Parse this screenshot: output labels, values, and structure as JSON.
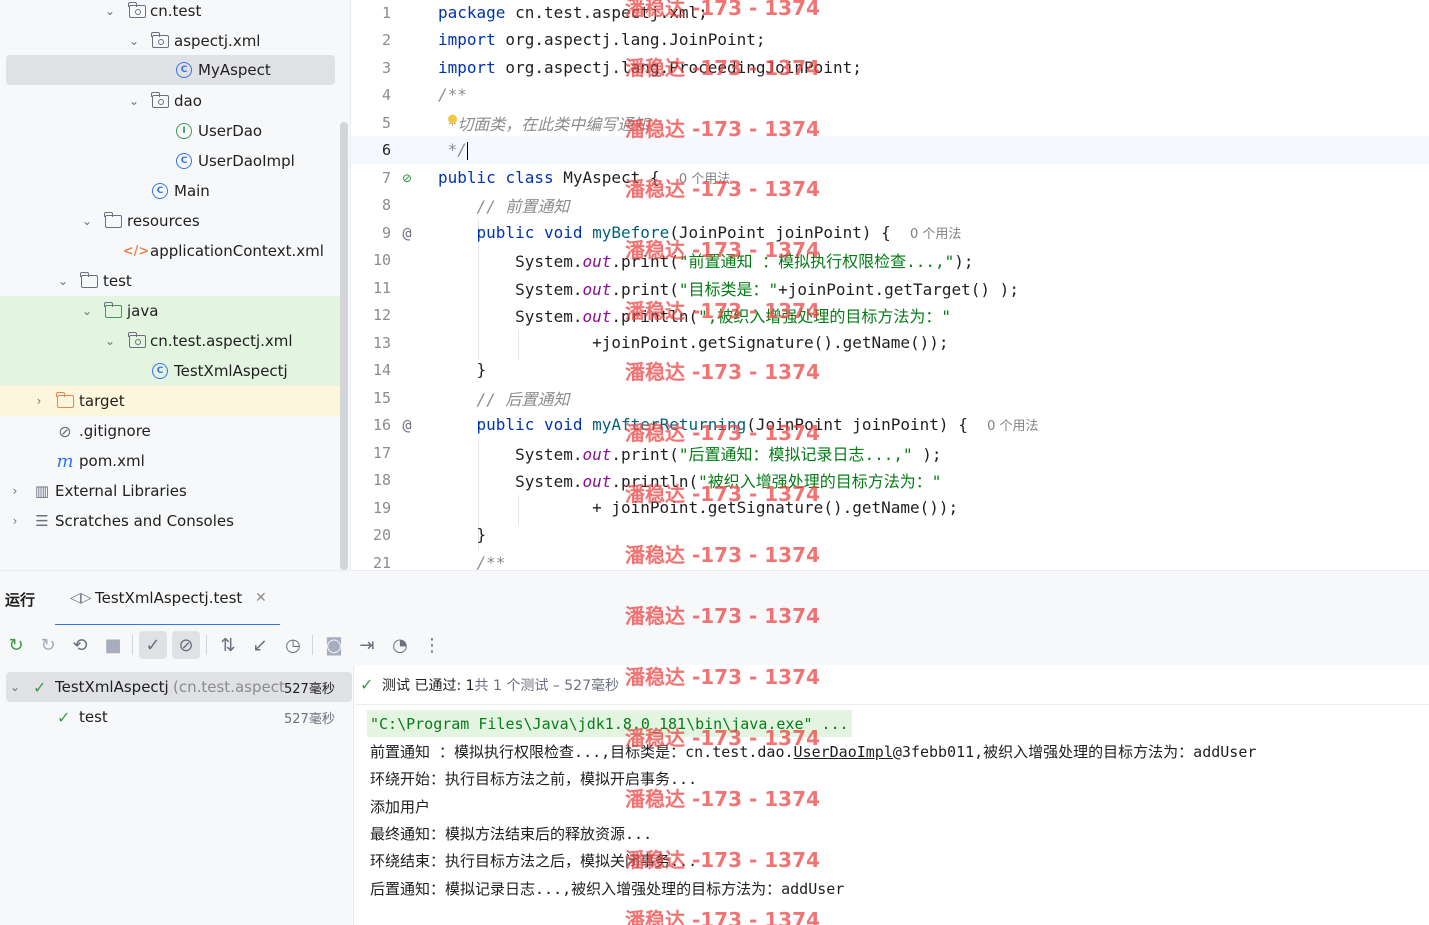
{
  "project_tree": {
    "items": [
      {
        "label": "cn.test",
        "icon": "package-icon"
      },
      {
        "label": "aspectj.xml",
        "icon": "package-icon"
      },
      {
        "label": "MyAspect",
        "icon": "class-icon"
      },
      {
        "label": "dao",
        "icon": "package-icon"
      },
      {
        "label": "UserDao",
        "icon": "interface-icon"
      },
      {
        "label": "UserDaoImpl",
        "icon": "class-icon"
      },
      {
        "label": "Main",
        "icon": "main-class-icon"
      },
      {
        "label": "resources",
        "icon": "resources-folder-icon"
      },
      {
        "label": "applicationContext.xml",
        "icon": "xml-file-icon"
      },
      {
        "label": "test",
        "icon": "folder-icon"
      },
      {
        "label": "java",
        "icon": "test-source-folder-icon"
      },
      {
        "label": "cn.test.aspectj.xml",
        "icon": "package-icon"
      },
      {
        "label": "TestXmlAspectj",
        "icon": "test-class-icon"
      },
      {
        "label": "target",
        "icon": "excluded-folder-icon"
      },
      {
        "label": ".gitignore",
        "icon": "ignore-file-icon"
      },
      {
        "label": "pom.xml",
        "icon": "maven-icon"
      },
      {
        "label": "External Libraries",
        "icon": "library-icon"
      },
      {
        "label": "Scratches and Consoles",
        "icon": "scratches-icon"
      }
    ],
    "icon_letters": {
      "class": "C",
      "interface": "I"
    }
  },
  "editor": {
    "line_numbers": [
      "1",
      "2",
      "3",
      "4",
      "5",
      "6",
      "7",
      "8",
      "9",
      "10",
      "11",
      "12",
      "13",
      "14",
      "15",
      "16",
      "17",
      "18",
      "19",
      "20",
      "21"
    ],
    "tokens": {
      "l1_kw": "package",
      "l1_rest": " cn.test.aspectj.xml;",
      "l2_kw": "import",
      "l2_rest": " org.aspectj.lang.JoinPoint;",
      "l3_kw": "import",
      "l3_rest": " org.aspectj.lang.ProceedingJoinPoint;",
      "l4_cmt": "/**",
      "l5_cmt": " *切面类，在此类中编写通知",
      "l6_cmt": " */",
      "l7_kw1": "public",
      "l7_kw2": "class",
      "l7_rest": " MyAspect {",
      "l7_hint": "0 个用法",
      "l8_cmt": "    // 前置通知",
      "l9_kw1": "public",
      "l9_kw2": "void",
      "l9_fn": "myBefore",
      "l9_rest": "(JoinPoint joinPoint) {",
      "l9_hint": "0 个用法",
      "l10_a": "System.",
      "l10_field": "out",
      "l10_b": ".print(",
      "l10_str": "\"前置通知 ：模拟执行权限检查...,\"",
      "l10_c": ");",
      "l11_a": "System.",
      "l11_field": "out",
      "l11_b": ".print(",
      "l11_str": "\"目标类是：\"",
      "l11_c": "+joinPoint.getTarget() );",
      "l12_a": "System.",
      "l12_field": "out",
      "l12_b": ".println(",
      "l12_str": "\",被织入增强处理的目标方法为：\"",
      "l13_a": "+joinPoint.getSignature().getName());",
      "l14_a": "}",
      "l15_cmt": "// 后置通知",
      "l16_kw1": "public",
      "l16_kw2": "void",
      "l16_fn": "myAfterReturning",
      "l16_rest": "(JoinPoint joinPoint) {",
      "l16_hint": "0 个用法",
      "l17_a": "System.",
      "l17_field": "out",
      "l17_b": ".print(",
      "l17_str": "\"后置通知：模拟记录日志...,\"",
      "l17_c": " );",
      "l18_a": "System.",
      "l18_field": "out",
      "l18_b": ".println(",
      "l18_str": "\"被织入增强处理的目标方法为：\"",
      "l19_a": "+ joinPoint.getSignature().getName());",
      "l20_a": "}",
      "l21_cmt": "/**"
    },
    "current_line": 6
  },
  "run_window": {
    "title": "运行",
    "tab_label": "TestXmlAspectj.test",
    "toolbar_icons": [
      "rerun-icon",
      "rerun-failed-icon",
      "toggle-auto-test-icon",
      "stop-icon",
      "show-passed-icon",
      "show-ignored-icon",
      "sort-icon",
      "collapse-icon",
      "history-icon",
      "screenshot-icon",
      "import-tests-icon",
      "coverage-icon",
      "more-icon"
    ]
  },
  "test_tree": {
    "root_label": "TestXmlAspectj",
    "root_package": "(cn.test.aspect",
    "root_time": "527毫秒",
    "child_label": "test",
    "child_time": "527毫秒"
  },
  "console": {
    "status_prefix": "测试 已通过: ",
    "status_count": "1",
    "status_suffix": "共 1 个测试 – 527毫秒",
    "cmd_line": "\"C:\\Program Files\\Java\\jdk1.8.0_181\\bin\\java.exe\" ...",
    "line1_a": "前置通知 ：模拟执行权限检查...,目标类是：cn.test.dao.",
    "line1_link": "UserDaoImpl",
    "line1_b": "@3febb011,被织入增强处理的目标方法为：addUser",
    "line2": "环绕开始：执行目标方法之前，模拟开启事务...",
    "line3": "添加用户",
    "line4": "最终通知：模拟方法结束后的释放资源...",
    "line5": "环绕结束：执行目标方法之后，模拟关闭事务...",
    "line6": "后置通知：模拟记录日志...,被织入增强处理的目标方法为：addUser"
  },
  "watermark": {
    "text": "潘稳达 -173 - 1374"
  }
}
